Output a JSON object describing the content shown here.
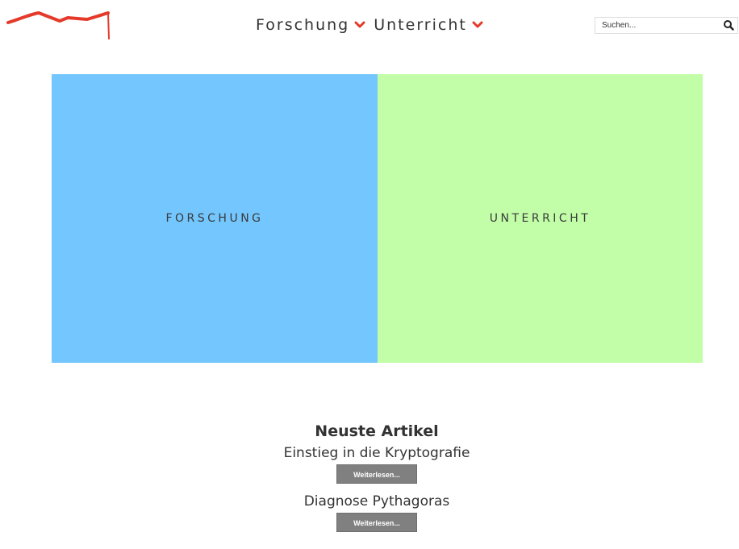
{
  "header": {
    "nav": [
      {
        "label": "Forschung",
        "icon": "chevron-down-icon"
      },
      {
        "label": "Unterricht",
        "icon": "chevron-down-icon"
      }
    ],
    "search": {
      "placeholder": "Suchen...",
      "value": "",
      "icon": "search-icon"
    }
  },
  "tiles": [
    {
      "label": "FORSCHUNG",
      "color": "#73c6fe"
    },
    {
      "label": "UNTERRICHT",
      "color": "#c2fea8"
    }
  ],
  "articles": {
    "heading": "Neuste Artikel",
    "items": [
      {
        "title": "Einstieg in die Kryptografie",
        "button": "Weiterlesen..."
      },
      {
        "title": "Diagnose Pythagoras",
        "button": "Weiterlesen..."
      }
    ]
  },
  "colors": {
    "accent": "#e53a2a",
    "read_more_bg": "#808080"
  }
}
